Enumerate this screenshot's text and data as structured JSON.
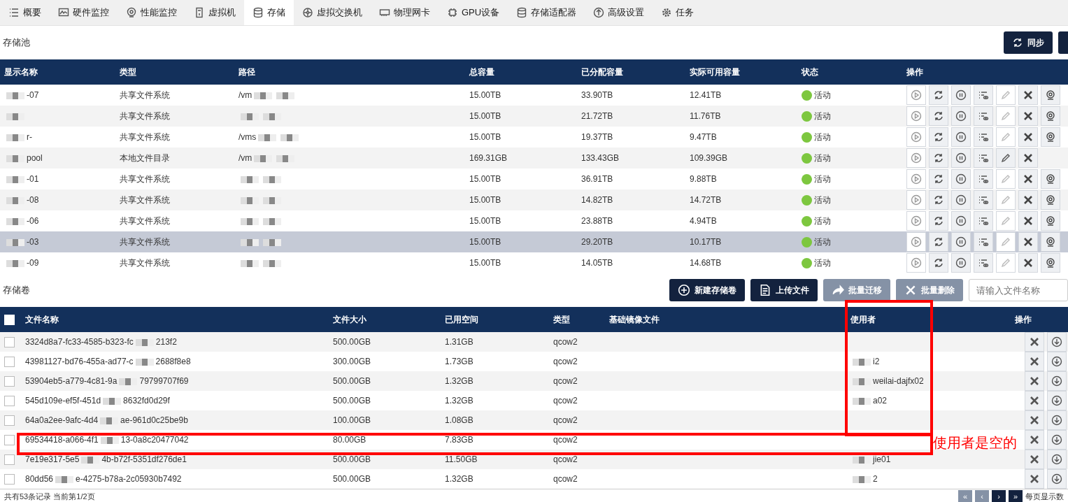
{
  "tabs": [
    {
      "label": "概要",
      "selected": false
    },
    {
      "label": "硬件监控",
      "selected": false
    },
    {
      "label": "性能监控",
      "selected": false
    },
    {
      "label": "虚拟机",
      "selected": false
    },
    {
      "label": "存储",
      "selected": true
    },
    {
      "label": "虚拟交换机",
      "selected": false
    },
    {
      "label": "物理网卡",
      "selected": false
    },
    {
      "label": "GPU设备",
      "selected": false
    },
    {
      "label": "存储适配器",
      "selected": false
    },
    {
      "label": "高级设置",
      "selected": false
    },
    {
      "label": "任务",
      "selected": false
    }
  ],
  "pool_section": {
    "title": "存储池",
    "sync_button": "同步"
  },
  "pool_table": {
    "columns": [
      "显示名称",
      "类型",
      "路径",
      "总容量",
      "已分配容量",
      "实际可用容量",
      "状态",
      "操作"
    ],
    "rows": [
      {
        "name": "-07",
        "type": "共享文件系统",
        "path": "/vm",
        "total": "15.00TB",
        "allocated": "33.90TB",
        "available": "12.41TB",
        "status": "活动",
        "color": "#7dc73f",
        "selected": false,
        "edit_enabled": false,
        "has_mount": true
      },
      {
        "name": "",
        "type": "共享文件系统",
        "path": "",
        "total": "15.00TB",
        "allocated": "21.72TB",
        "available": "11.76TB",
        "status": "活动",
        "color": "#7dc73f",
        "selected": false,
        "edit_enabled": false,
        "has_mount": true
      },
      {
        "name": "r-",
        "type": "共享文件系统",
        "path": "/vms",
        "total": "15.00TB",
        "allocated": "19.37TB",
        "available": "9.47TB",
        "status": "活动",
        "color": "#7dc73f",
        "selected": false,
        "edit_enabled": false,
        "has_mount": true
      },
      {
        "name": "pool",
        "type": "本地文件目录",
        "path": "/vm",
        "total": "169.31GB",
        "allocated": "133.43GB",
        "available": "109.39GB",
        "status": "活动",
        "color": "#7dc73f",
        "selected": false,
        "edit_enabled": true,
        "has_mount": false
      },
      {
        "name": "-01",
        "type": "共享文件系统",
        "path": "",
        "total": "15.00TB",
        "allocated": "36.91TB",
        "available": "9.88TB",
        "status": "活动",
        "color": "#7dc73f",
        "selected": false,
        "edit_enabled": false,
        "has_mount": true
      },
      {
        "name": "-08",
        "type": "共享文件系统",
        "path": "",
        "total": "15.00TB",
        "allocated": "14.82TB",
        "available": "14.72TB",
        "status": "活动",
        "color": "#7dc73f",
        "selected": false,
        "edit_enabled": false,
        "has_mount": true
      },
      {
        "name": "-06",
        "type": "共享文件系统",
        "path": "",
        "total": "15.00TB",
        "allocated": "23.88TB",
        "available": "4.94TB",
        "status": "活动",
        "color": "#7dc73f",
        "selected": false,
        "edit_enabled": false,
        "has_mount": true
      },
      {
        "name": "-03",
        "type": "共享文件系统",
        "path": "",
        "total": "15.00TB",
        "allocated": "29.20TB",
        "available": "10.17TB",
        "status": "活动",
        "color": "#7dc73f",
        "selected": true,
        "edit_enabled": false,
        "has_mount": true
      },
      {
        "name": "-09",
        "type": "共享文件系统",
        "path": "",
        "total": "15.00TB",
        "allocated": "14.05TB",
        "available": "14.68TB",
        "status": "活动",
        "color": "#7dc73f",
        "selected": false,
        "edit_enabled": false,
        "has_mount": true
      }
    ]
  },
  "volume_section": {
    "title": "存储卷",
    "buttons": [
      {
        "label": "新建存储卷",
        "disabled": false
      },
      {
        "label": "上传文件",
        "disabled": false
      },
      {
        "label": "批量迁移",
        "disabled": true
      },
      {
        "label": "批量删除",
        "disabled": true
      }
    ],
    "search": {
      "placeholder": "请输入文件名称"
    }
  },
  "volume_table": {
    "columns": [
      "文件名称",
      "文件大小",
      "已用空间",
      "类型",
      "基础镜像文件",
      "使用者",
      "操作"
    ],
    "header_checked": false,
    "rows": [
      {
        "name_start": "3324d8a7-fc33-4585-b323-fc",
        "name_end": "213f2",
        "size": "500.00GB",
        "used": "1.31GB",
        "type": "qcow2",
        "user": "",
        "checked": false
      },
      {
        "name_start": "43981127-bd76-455a-ad77-c",
        "name_end": "2688f8e8",
        "size": "300.00GB",
        "used": "1.73GB",
        "type": "qcow2",
        "user": "i2",
        "checked": false
      },
      {
        "name_start": "53904eb5-a779-4c81-9a",
        "name_end": "79799707f69",
        "size": "500.00GB",
        "used": "1.32GB",
        "type": "qcow2",
        "user": "weilai-dajfx02",
        "checked": false
      },
      {
        "name_start": "545d109e-ef5f-451d",
        "name_end": "8632fd0d29f",
        "size": "500.00GB",
        "used": "1.32GB",
        "type": "qcow2",
        "user": "a02",
        "checked": false
      },
      {
        "name_start": "64a0a2ee-9afc-4d4",
        "name_end": "ae-961d0c25be9b",
        "size": "100.00GB",
        "used": "1.08GB",
        "type": "qcow2",
        "user": "",
        "checked": false
      },
      {
        "name_start": "69534418-a066-4f1",
        "name_end": "13-0a8c20477042",
        "size": "80.00GB",
        "used": "7.83GB",
        "type": "qcow2",
        "user": "",
        "checked": false
      },
      {
        "name_start": "7e19e317-5e5",
        "name_end": "4b-b72f-5351df276de1",
        "size": "500.00GB",
        "used": "11.50GB",
        "type": "qcow2",
        "user": "jie01",
        "checked": false
      },
      {
        "name_start": "80dd56",
        "name_end": "e-4275-b78a-2c05930b7492",
        "size": "500.00GB",
        "used": "1.32GB",
        "type": "qcow2",
        "user": "2",
        "checked": false
      }
    ]
  },
  "footer": {
    "summary": "共有53条记录 当前第1/2页",
    "pager": [
      "«",
      "‹",
      "›",
      "»"
    ],
    "page_size_label": "每页显示数"
  },
  "annotation": {
    "text": "使用者是空的"
  }
}
